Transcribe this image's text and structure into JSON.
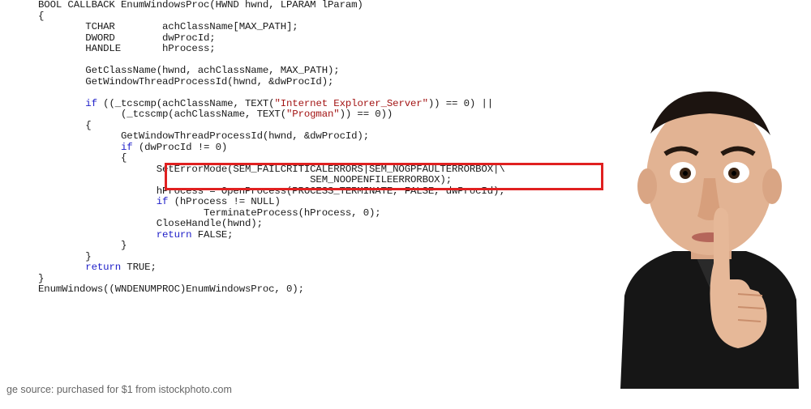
{
  "code_lines": [
    [
      {
        "t": "BOOL CALLBACK EnumWindowsProc(HWND hwnd, LPARAM lParam)",
        "c": "tx"
      }
    ],
    [
      {
        "t": "{",
        "c": "tx"
      }
    ],
    [
      {
        "t": "        TCHAR        achClassName[MAX_PATH];",
        "c": "tx"
      }
    ],
    [
      {
        "t": "        DWORD        dwProcId;",
        "c": "tx"
      }
    ],
    [
      {
        "t": "        HANDLE       hProcess;",
        "c": "tx"
      }
    ],
    [
      {
        "t": "",
        "c": "tx"
      }
    ],
    [
      {
        "t": "        GetClassName(hwnd, achClassName, MAX_PATH);",
        "c": "tx"
      }
    ],
    [
      {
        "t": "        GetWindowThreadProcessId(hwnd, &dwProcId);",
        "c": "tx"
      }
    ],
    [
      {
        "t": "",
        "c": "tx"
      }
    ],
    [
      {
        "t": "        ",
        "c": "tx"
      },
      {
        "t": "if",
        "c": "kw"
      },
      {
        "t": " ((_tcscmp(achClassName, TEXT(",
        "c": "tx"
      },
      {
        "t": "\"Internet Explorer_Server\"",
        "c": "str"
      },
      {
        "t": ")) == 0) ||",
        "c": "tx"
      }
    ],
    [
      {
        "t": "              (_tcscmp(achClassName, TEXT(",
        "c": "tx"
      },
      {
        "t": "\"Progman\"",
        "c": "str"
      },
      {
        "t": ")) == 0))",
        "c": "tx"
      }
    ],
    [
      {
        "t": "        {",
        "c": "tx"
      }
    ],
    [
      {
        "t": "              GetWindowThreadProcessId(hwnd, &dwProcId);",
        "c": "tx"
      }
    ],
    [
      {
        "t": "              ",
        "c": "tx"
      },
      {
        "t": "if",
        "c": "kw"
      },
      {
        "t": " (dwProcId != 0)",
        "c": "tx"
      }
    ],
    [
      {
        "t": "              {",
        "c": "tx"
      }
    ],
    [
      {
        "t": "                    SetErrorMode(SEM_FAILCRITICALERRORS|SEM_NOGPFAULTERRORBOX|\\",
        "c": "tx"
      }
    ],
    [
      {
        "t": "                                              SEM_NOOPENFILEERRORBOX);",
        "c": "tx"
      }
    ],
    [
      {
        "t": "                    hProcess = OpenProcess(PROCESS_TERMINATE, FALSE, dwProcId);",
        "c": "tx"
      }
    ],
    [
      {
        "t": "                    ",
        "c": "tx"
      },
      {
        "t": "if",
        "c": "kw"
      },
      {
        "t": " (hProcess != NULL)",
        "c": "tx"
      }
    ],
    [
      {
        "t": "                            TerminateProcess(hProcess, 0);",
        "c": "tx"
      }
    ],
    [
      {
        "t": "                    CloseHandle(hwnd);",
        "c": "tx"
      }
    ],
    [
      {
        "t": "                    ",
        "c": "tx"
      },
      {
        "t": "return",
        "c": "kw"
      },
      {
        "t": " FALSE;",
        "c": "tx"
      }
    ],
    [
      {
        "t": "              }",
        "c": "tx"
      }
    ],
    [
      {
        "t": "        }",
        "c": "tx"
      }
    ],
    [
      {
        "t": "        ",
        "c": "tx"
      },
      {
        "t": "return",
        "c": "kw"
      },
      {
        "t": " TRUE;",
        "c": "tx"
      }
    ],
    [
      {
        "t": "}",
        "c": "tx"
      }
    ],
    [
      {
        "t": "EnumWindows((WNDENUMPROC)EnumWindowsProc, 0);",
        "c": "tx"
      }
    ]
  ],
  "caption": "ge source: purchased for $1 from istockphoto.com",
  "colors": {
    "keyword": "#1e1ec8",
    "string": "#a31515",
    "highlight_border": "#e02020"
  },
  "photo": {
    "icon": "man-shushing-photo"
  }
}
